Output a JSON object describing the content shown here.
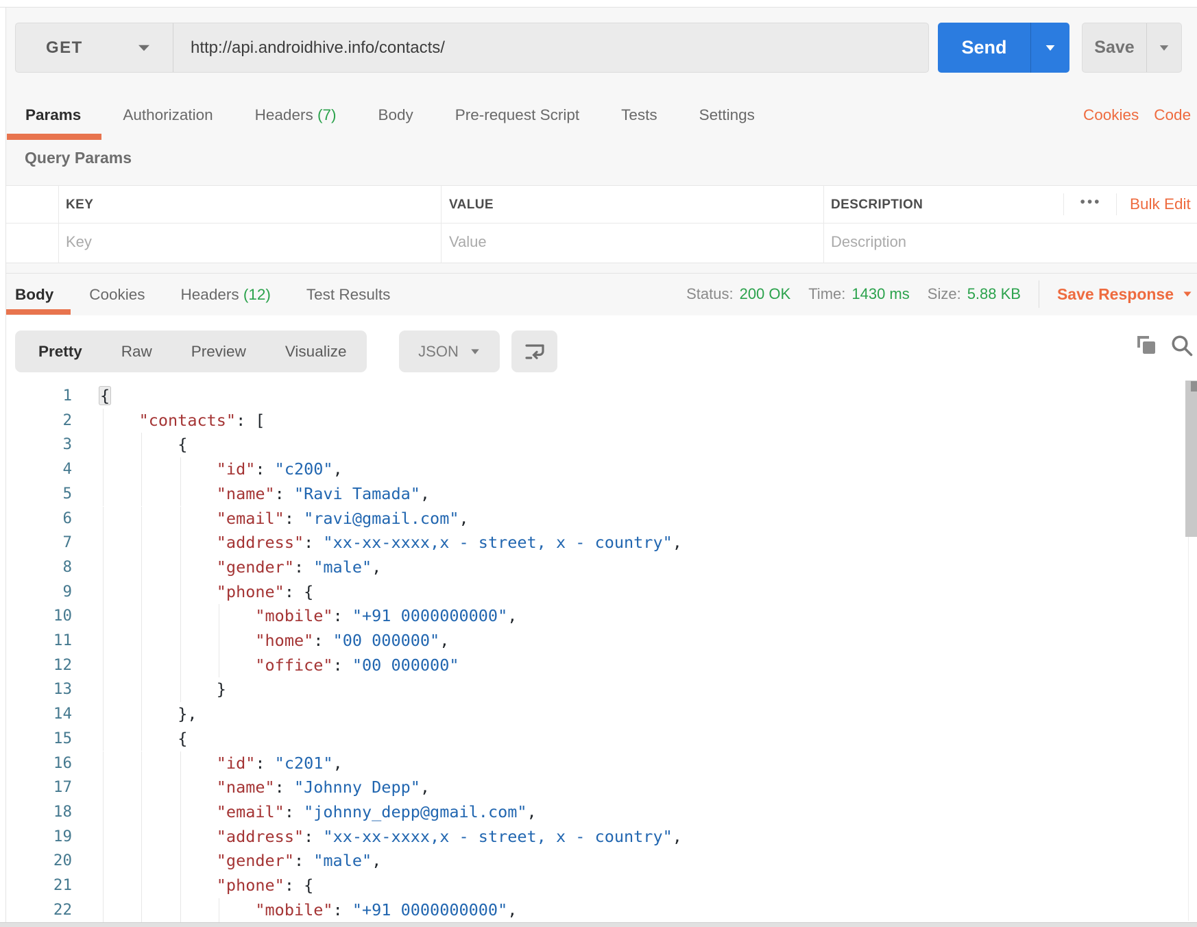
{
  "request": {
    "method": "GET",
    "url": "http://api.androidhive.info/contacts/",
    "send_label": "Send",
    "save_label": "Save",
    "tabs": [
      {
        "label": "Params",
        "active": true
      },
      {
        "label": "Authorization"
      },
      {
        "label": "Headers",
        "count": "(7)"
      },
      {
        "label": "Body"
      },
      {
        "label": "Pre-request Script"
      },
      {
        "label": "Tests"
      },
      {
        "label": "Settings"
      }
    ],
    "links": {
      "cookies": "Cookies",
      "code": "Code"
    }
  },
  "query_params": {
    "title": "Query Params",
    "columns": [
      "KEY",
      "VALUE",
      "DESCRIPTION"
    ],
    "bulk_edit_label": "Bulk Edit",
    "more_options_glyph": "•••",
    "placeholders": {
      "key": "Key",
      "value": "Value",
      "description": "Description"
    }
  },
  "response": {
    "tabs": [
      {
        "label": "Body",
        "active": true
      },
      {
        "label": "Cookies"
      },
      {
        "label": "Headers",
        "count": "(12)"
      },
      {
        "label": "Test Results"
      }
    ],
    "meta": [
      {
        "label": "Status:",
        "value": "200 OK"
      },
      {
        "label": "Time:",
        "value": "1430 ms"
      },
      {
        "label": "Size:",
        "value": "5.88 KB"
      }
    ],
    "save_response_label": "Save Response",
    "view_tabs": [
      {
        "label": "Pretty",
        "active": true
      },
      {
        "label": "Raw"
      },
      {
        "label": "Preview"
      },
      {
        "label": "Visualize"
      }
    ],
    "format_selected": "JSON"
  },
  "colors": {
    "accent_orange": "#ee6b3f",
    "tab_underline": "#e8744e",
    "send_blue": "#2b7ce0",
    "status_green": "#2ba24c",
    "code_key": "#a43434",
    "code_value": "#2166b0",
    "line_number": "#45798f"
  },
  "code": {
    "lines": [
      {
        "n": 1,
        "i": 0,
        "segs": [
          [
            "p",
            "{",
            "hl"
          ]
        ]
      },
      {
        "n": 2,
        "i": 1,
        "segs": [
          [
            "k",
            "\"contacts\""
          ],
          [
            "p",
            ": ["
          ]
        ]
      },
      {
        "n": 3,
        "i": 2,
        "segs": [
          [
            "p",
            "{"
          ]
        ]
      },
      {
        "n": 4,
        "i": 3,
        "segs": [
          [
            "k",
            "\"id\""
          ],
          [
            "p",
            ": "
          ],
          [
            "v",
            "\"c200\""
          ],
          [
            "p",
            ","
          ]
        ]
      },
      {
        "n": 5,
        "i": 3,
        "segs": [
          [
            "k",
            "\"name\""
          ],
          [
            "p",
            ": "
          ],
          [
            "v",
            "\"Ravi Tamada\""
          ],
          [
            "p",
            ","
          ]
        ]
      },
      {
        "n": 6,
        "i": 3,
        "segs": [
          [
            "k",
            "\"email\""
          ],
          [
            "p",
            ": "
          ],
          [
            "v",
            "\"ravi@gmail.com\""
          ],
          [
            "p",
            ","
          ]
        ]
      },
      {
        "n": 7,
        "i": 3,
        "segs": [
          [
            "k",
            "\"address\""
          ],
          [
            "p",
            ": "
          ],
          [
            "v",
            "\"xx-xx-xxxx,x - street, x - country\""
          ],
          [
            "p",
            ","
          ]
        ]
      },
      {
        "n": 8,
        "i": 3,
        "segs": [
          [
            "k",
            "\"gender\""
          ],
          [
            "p",
            ": "
          ],
          [
            "v",
            "\"male\""
          ],
          [
            "p",
            ","
          ]
        ]
      },
      {
        "n": 9,
        "i": 3,
        "segs": [
          [
            "k",
            "\"phone\""
          ],
          [
            "p",
            ": {"
          ]
        ]
      },
      {
        "n": 10,
        "i": 4,
        "segs": [
          [
            "k",
            "\"mobile\""
          ],
          [
            "p",
            ": "
          ],
          [
            "v",
            "\"+91 0000000000\""
          ],
          [
            "p",
            ","
          ]
        ]
      },
      {
        "n": 11,
        "i": 4,
        "segs": [
          [
            "k",
            "\"home\""
          ],
          [
            "p",
            ": "
          ],
          [
            "v",
            "\"00 000000\""
          ],
          [
            "p",
            ","
          ]
        ]
      },
      {
        "n": 12,
        "i": 4,
        "segs": [
          [
            "k",
            "\"office\""
          ],
          [
            "p",
            ": "
          ],
          [
            "v",
            "\"00 000000\""
          ]
        ]
      },
      {
        "n": 13,
        "i": 3,
        "segs": [
          [
            "p",
            "}"
          ]
        ]
      },
      {
        "n": 14,
        "i": 2,
        "segs": [
          [
            "p",
            "},"
          ]
        ]
      },
      {
        "n": 15,
        "i": 2,
        "segs": [
          [
            "p",
            "{"
          ]
        ]
      },
      {
        "n": 16,
        "i": 3,
        "segs": [
          [
            "k",
            "\"id\""
          ],
          [
            "p",
            ": "
          ],
          [
            "v",
            "\"c201\""
          ],
          [
            "p",
            ","
          ]
        ]
      },
      {
        "n": 17,
        "i": 3,
        "segs": [
          [
            "k",
            "\"name\""
          ],
          [
            "p",
            ": "
          ],
          [
            "v",
            "\"Johnny Depp\""
          ],
          [
            "p",
            ","
          ]
        ]
      },
      {
        "n": 18,
        "i": 3,
        "segs": [
          [
            "k",
            "\"email\""
          ],
          [
            "p",
            ": "
          ],
          [
            "v",
            "\"johnny_depp@gmail.com\""
          ],
          [
            "p",
            ","
          ]
        ]
      },
      {
        "n": 19,
        "i": 3,
        "segs": [
          [
            "k",
            "\"address\""
          ],
          [
            "p",
            ": "
          ],
          [
            "v",
            "\"xx-xx-xxxx,x - street, x - country\""
          ],
          [
            "p",
            ","
          ]
        ]
      },
      {
        "n": 20,
        "i": 3,
        "segs": [
          [
            "k",
            "\"gender\""
          ],
          [
            "p",
            ": "
          ],
          [
            "v",
            "\"male\""
          ],
          [
            "p",
            ","
          ]
        ]
      },
      {
        "n": 21,
        "i": 3,
        "segs": [
          [
            "k",
            "\"phone\""
          ],
          [
            "p",
            ": {"
          ]
        ]
      },
      {
        "n": 22,
        "i": 4,
        "segs": [
          [
            "k",
            "\"mobile\""
          ],
          [
            "p",
            ": "
          ],
          [
            "v",
            "\"+91 0000000000\""
          ],
          [
            "p",
            ","
          ]
        ]
      }
    ]
  }
}
